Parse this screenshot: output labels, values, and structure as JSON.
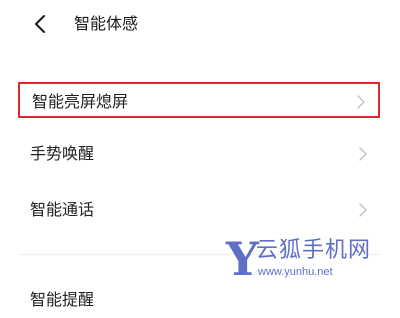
{
  "header": {
    "back_icon": "chevron-left-icon",
    "title": "智能体感"
  },
  "settings": {
    "items": [
      {
        "label": "智能亮屏熄屏",
        "icon": "chevron-right-icon",
        "highlighted": true
      },
      {
        "label": "手势唤醒",
        "icon": "chevron-right-icon"
      },
      {
        "label": "智能通话",
        "icon": "chevron-right-icon"
      },
      {
        "label": "智能提醒",
        "icon": "chevron-right-icon"
      }
    ]
  },
  "watermark": {
    "logo_letter": "Y",
    "name": "云狐手机网",
    "url": "www.yunhu.net"
  },
  "colors": {
    "highlight_border": "#e0282e",
    "chevron": "#c4c4c4",
    "watermark": "#5f6fc5"
  }
}
